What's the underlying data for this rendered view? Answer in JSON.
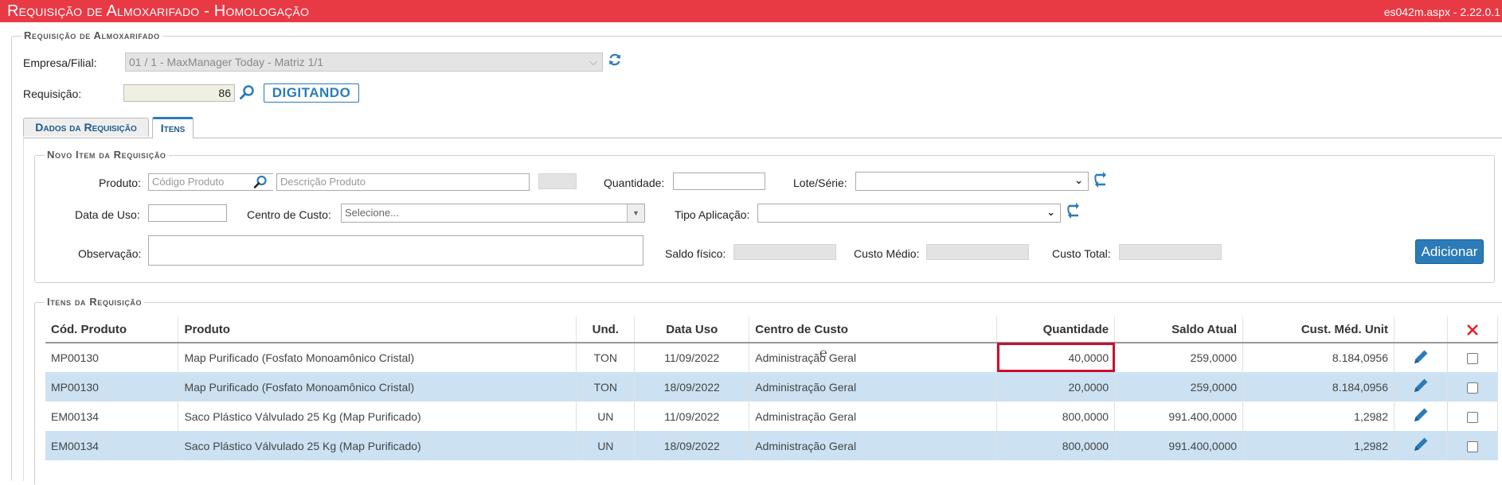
{
  "header": {
    "title": "Requisição de Almoxarifado  - Homologação",
    "version": "es042m.aspx - 2.22.0.1"
  },
  "requisicao": {
    "legend": "Requisição de Almoxarifado",
    "empresa_label": "Empresa/Filial:",
    "empresa_value": "01 / 1 - MaxManager Today - Matriz 1/1",
    "requisicao_label": "Requisição:",
    "requisicao_value": "86",
    "status": "DIGITANDO"
  },
  "tabs": [
    {
      "label": "Dados da Requisição",
      "active": false
    },
    {
      "label": "Itens",
      "active": true
    }
  ],
  "novo_item": {
    "legend": "Novo Item da Requisição",
    "produto_label": "Produto:",
    "codigo_placeholder": "Código Produto",
    "descricao_placeholder": "Descrição Produto",
    "quantidade_label": "Quantidade:",
    "lote_label": "Lote/Série:",
    "data_uso_label": "Data de Uso:",
    "centro_label": "Centro de Custo:",
    "centro_placeholder": "Selecione...",
    "tipo_label": "Tipo Aplicação:",
    "observacao_label": "Observação:",
    "saldo_label": "Saldo físico:",
    "custo_medio_label": "Custo Médio:",
    "custo_total_label": "Custo Total:",
    "add_button": "Adicionar"
  },
  "itens": {
    "legend": "Itens da Requisição",
    "columns": [
      "Cód. Produto",
      "Produto",
      "Und.",
      "Data Uso",
      "Centro de Custo",
      "Quantidade",
      "Saldo Atual",
      "Cust. Méd. Unit"
    ],
    "rows": [
      {
        "codigo": "MP00130",
        "produto": "Map Purificado (Fosfato Monoamônico Cristal)",
        "und": "TON",
        "data": "11/09/2022",
        "centro": "Administração Geral",
        "quantidade": "40,0000",
        "saldo": "259,0000",
        "custo": "8.184,0956",
        "highlighted_cell": "quantidade"
      },
      {
        "codigo": "MP00130",
        "produto": "Map Purificado (Fosfato Monoamônico Cristal)",
        "und": "TON",
        "data": "18/09/2022",
        "centro": "Administração Geral",
        "quantidade": "20,0000",
        "saldo": "259,0000",
        "custo": "8.184,0956"
      },
      {
        "codigo": "EM00134",
        "produto": "Saco Plástico Válvulado 25 Kg (Map Purificado)",
        "und": "UN",
        "data": "11/09/2022",
        "centro": "Administração Geral",
        "quantidade": "800,0000",
        "saldo": "991.400,0000",
        "custo": "1,2982"
      },
      {
        "codigo": "EM00134",
        "produto": "Saco Plástico Válvulado 25 Kg (Map Purificado)",
        "und": "UN",
        "data": "18/09/2022",
        "centro": "Administração Geral",
        "quantidade": "800,0000",
        "saldo": "991.400,0000",
        "custo": "1,2982"
      }
    ]
  },
  "colors": {
    "title_bar": "#e83a44",
    "accent_blue": "#2b7bb9",
    "row_alt": "#cce2f2",
    "highlight_border": "#c8102e",
    "delete_x": "#e02020"
  },
  "icons": [
    "refresh-icon",
    "search-icon",
    "chevron-down-icon",
    "edit-pencil-icon",
    "delete-x-icon"
  ]
}
